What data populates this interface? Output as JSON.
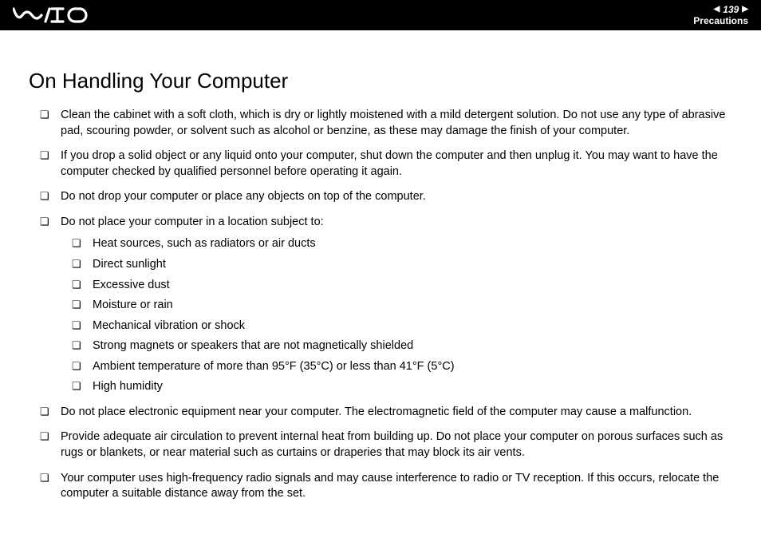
{
  "header": {
    "page_number": "139",
    "section": "Precautions"
  },
  "title": "On Handling Your Computer",
  "bullets": {
    "b1": "Clean the cabinet with a soft cloth, which is dry or lightly moistened with a mild detergent solution. Do not use any type of abrasive pad, scouring powder, or solvent such as alcohol or benzine, as these may damage the finish of your computer.",
    "b2": "If you drop a solid object or any liquid onto your computer, shut down the computer and then unplug it. You may want to have the computer checked by qualified personnel before operating it again.",
    "b3": "Do not drop your computer or place any objects on top of the computer.",
    "b4": "Do not place your computer in a location subject to:",
    "b4_sub": {
      "s1": "Heat sources, such as radiators or air ducts",
      "s2": "Direct sunlight",
      "s3": "Excessive dust",
      "s4": "Moisture or rain",
      "s5": "Mechanical vibration or shock",
      "s6": "Strong magnets or speakers that are not magnetically shielded",
      "s7": "Ambient temperature of more than 95°F (35°C) or less than 41°F (5°C)",
      "s8": "High humidity"
    },
    "b5": "Do not place electronic equipment near your computer. The electromagnetic field of the computer may cause a malfunction.",
    "b6": "Provide adequate air circulation to prevent internal heat from building up. Do not place your computer on porous surfaces such as rugs or blankets, or near material such as curtains or draperies that may block its air vents.",
    "b7": "Your computer uses high-frequency radio signals and may cause interference to radio or TV reception. If this occurs, relocate the computer a suitable distance away from the set."
  }
}
